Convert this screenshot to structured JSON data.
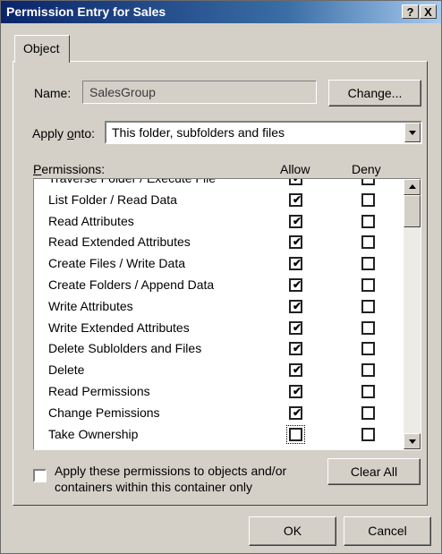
{
  "window": {
    "title": "Permission Entry for Sales",
    "help_button": "?",
    "close_button": "X"
  },
  "tabs": [
    {
      "label": "Object",
      "selected": true
    }
  ],
  "name_row": {
    "label": "Name:",
    "value": "SalesGroup",
    "change_button": "Change..."
  },
  "apply_onto": {
    "label_pre": "Apply ",
    "label_u": "o",
    "label_post": "nto:",
    "selected": "This folder, subfolders and files"
  },
  "permissions": {
    "label_u": "P",
    "label_rest": "ermissions:",
    "allow_header": "Allow",
    "deny_header": "Deny",
    "rows": [
      {
        "name": "Traverse Folder / Execute File",
        "allow": true,
        "deny": false
      },
      {
        "name": "List Folder / Read Data",
        "allow": true,
        "deny": false
      },
      {
        "name": "Read Attributes",
        "allow": true,
        "deny": false
      },
      {
        "name": "Read Extended Attributes",
        "allow": true,
        "deny": false
      },
      {
        "name": "Create Files / Write Data",
        "allow": true,
        "deny": false
      },
      {
        "name": "Create Folders / Append Data",
        "allow": true,
        "deny": false
      },
      {
        "name": "Write Attributes",
        "allow": true,
        "deny": false
      },
      {
        "name": "Write Extended Attributes",
        "allow": true,
        "deny": false
      },
      {
        "name": "Delete Sublolders and Files",
        "allow": true,
        "deny": false
      },
      {
        "name": "Delete",
        "allow": true,
        "deny": false
      },
      {
        "name": "Read Permissions",
        "allow": true,
        "deny": false
      },
      {
        "name": "Change Pemissions",
        "allow": true,
        "deny": false
      },
      {
        "name": "Take Ownership",
        "allow": false,
        "deny": false,
        "focused": true
      }
    ]
  },
  "apply_checkbox": {
    "line1": "Apply these permissions to objects and/or",
    "line2": "containers within this container only",
    "checked": false
  },
  "clear_all_button": "Clear All",
  "ok_button": "OK",
  "cancel_button": "Cancel",
  "colors": {
    "titlebar_start": "#0a246a",
    "titlebar_end": "#a6caf0",
    "dialog_face": "#d4d0c8"
  }
}
